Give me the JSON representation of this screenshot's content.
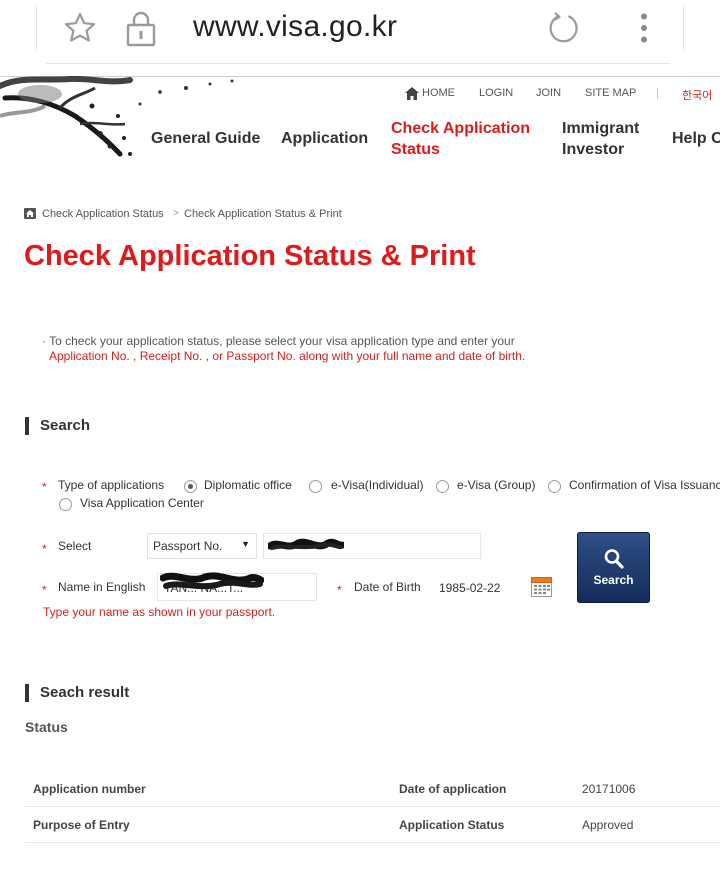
{
  "browser": {
    "url": "www.visa.go.kr",
    "icons": [
      "star-icon",
      "lock-icon",
      "reload-icon",
      "overflow-menu-icon"
    ]
  },
  "header": {
    "util_links": [
      "HOME",
      "LOGIN",
      "JOIN",
      "SITE MAP",
      "|",
      "한국어"
    ],
    "nav": {
      "general_guide": "General Guide",
      "application": "Application",
      "check_line1": "Check Application",
      "check_line2": "Status",
      "immigrant_line1": "Immigrant",
      "immigrant_line2": "Investor",
      "help": "Help C"
    },
    "accent_color": "#e01a1a"
  },
  "breadcrumb": {
    "item1": "Check Application Status",
    "arrow": ">",
    "item2": "Check Application Status & Print"
  },
  "page_title": "Check Application Status & Print",
  "notice": {
    "bullet": "·",
    "line1": "To check your application status, please select your visa application type and enter your",
    "line2_red": "Application No. , Receipt No. , or Passport No. along with your full name and date of birth."
  },
  "search": {
    "heading": "Search",
    "required_mark": "*",
    "type_label": "Type of applications",
    "options": {
      "diplomatic": "Diplomatic office",
      "evisa_individual": "e-Visa(Individual)",
      "evisa_group": "e-Visa (Group)",
      "confirmation": "Confirmation of Visa Issuance",
      "vac": "Visa Application Center"
    },
    "selected_option": "Diplomatic office",
    "select_label": "Select",
    "select_value": "Passport No.",
    "select_arrow": "▼",
    "name_label": "Name in English",
    "name_value": "TAN... NA...T...",
    "dob_label": "Date of Birth",
    "dob_value": "1985-02-22",
    "hint": "Type your name as shown in your passport.",
    "button_label": "Search"
  },
  "result": {
    "heading": "Seach result",
    "status_title": "Status",
    "rows": [
      {
        "label1": "Application number",
        "value1": "",
        "label2": "Date of application",
        "value2": "20171006"
      },
      {
        "label1": "Purpose of Entry",
        "value1": "",
        "label2": "Application Status",
        "value2": "Approved"
      }
    ]
  }
}
